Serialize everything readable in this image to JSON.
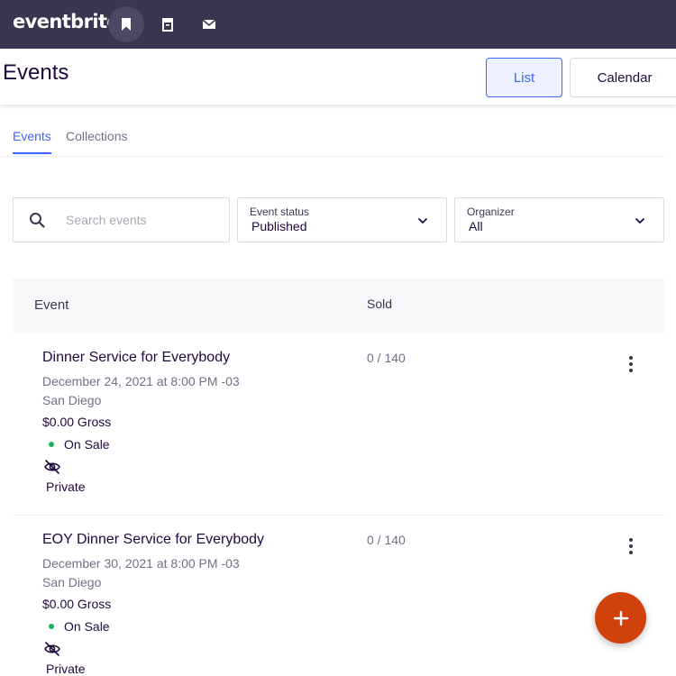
{
  "app": {
    "logo": "eventbrite"
  },
  "topbar": {
    "icons": [
      "bookmark-icon",
      "archive-icon",
      "mail-icon"
    ],
    "bg_color": "#39364f"
  },
  "header": {
    "title": "Events",
    "list_label": "List",
    "calendar_label": "Calendar"
  },
  "tabs": [
    "Events",
    "Collections"
  ],
  "filters": {
    "search_placeholder": "Search events",
    "status_label": "Event status",
    "status_value": "Published",
    "organizer_label": "Organizer",
    "organizer_value": "All"
  },
  "table": {
    "headers": {
      "event": "Event",
      "sold": "Sold"
    },
    "rows": [
      {
        "name": "Dinner Service for Everybody",
        "date": "December 24, 2021 at 8:00 PM -03",
        "location": "San Diego",
        "gross": "$0.00 Gross",
        "status": "On Sale",
        "visibility": "Private",
        "sold": "0 / 140"
      },
      {
        "name": "EOY Dinner Service for Everybody",
        "date": "December 30, 2021 at 8:00 PM -03",
        "location": "San Diego",
        "gross": "$0.00 Gross",
        "status": "On Sale",
        "visibility": "Private",
        "sold": "0 / 140"
      }
    ]
  },
  "colors": {
    "accent": "#3d64ff",
    "fab": "#d1410c",
    "status_on_sale": "#18b25b"
  }
}
